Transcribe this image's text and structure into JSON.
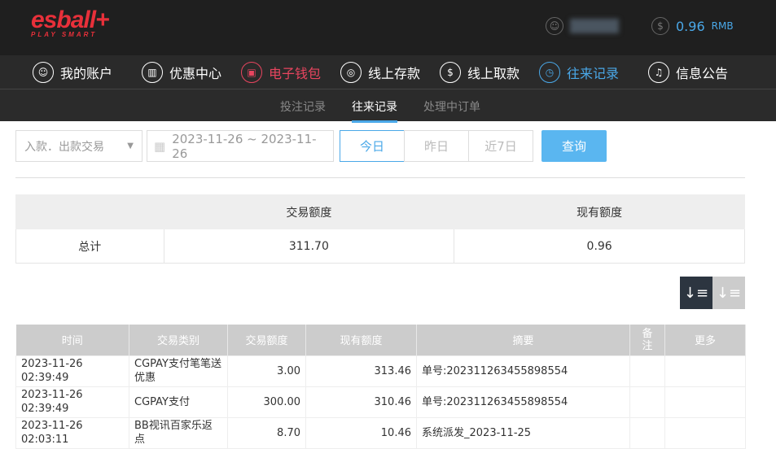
{
  "header": {
    "logo": "esball+",
    "logo_tagline": "PLAY SMART",
    "balance": "0.96",
    "currency": "RMB"
  },
  "nav": [
    {
      "label": "我的账户",
      "icon": "user-icon"
    },
    {
      "label": "优惠中心",
      "icon": "gift-icon"
    },
    {
      "label": "电子钱包",
      "icon": "wallet-icon"
    },
    {
      "label": "线上存款",
      "icon": "deposit-icon"
    },
    {
      "label": "线上取款",
      "icon": "withdraw-icon"
    },
    {
      "label": "往来记录",
      "icon": "records-icon"
    },
    {
      "label": "信息公告",
      "icon": "bell-icon"
    }
  ],
  "subnav": [
    "投注记录",
    "往来记录",
    "处理中订单"
  ],
  "filter": {
    "type": "入款．出款交易",
    "date_range": "2023-11-26 ~ 2023-11-26",
    "today": "今日",
    "yesterday": "昨日",
    "last7": "近7日",
    "query": "查询"
  },
  "summary": {
    "headers": [
      "",
      "交易额度",
      "现有额度"
    ],
    "row": [
      "总计",
      "311.70",
      "0.96"
    ]
  },
  "table": {
    "headers": [
      "时间",
      "交易类别",
      "交易额度",
      "现有额度",
      "摘要",
      "备注",
      "更多"
    ],
    "rows": [
      [
        "2023-11-26 02:39:49",
        "CGPAY支付笔笔送优惠",
        "3.00",
        "313.46",
        "单号:202311263455898554",
        "",
        ""
      ],
      [
        "2023-11-26 02:39:49",
        "CGPAY支付",
        "300.00",
        "310.46",
        "单号:202311263455898554",
        "",
        ""
      ],
      [
        "2023-11-26 02:03:11",
        "BB视讯百家乐返点",
        "8.70",
        "10.46",
        "系统派发_2023-11-25",
        "",
        ""
      ]
    ]
  }
}
